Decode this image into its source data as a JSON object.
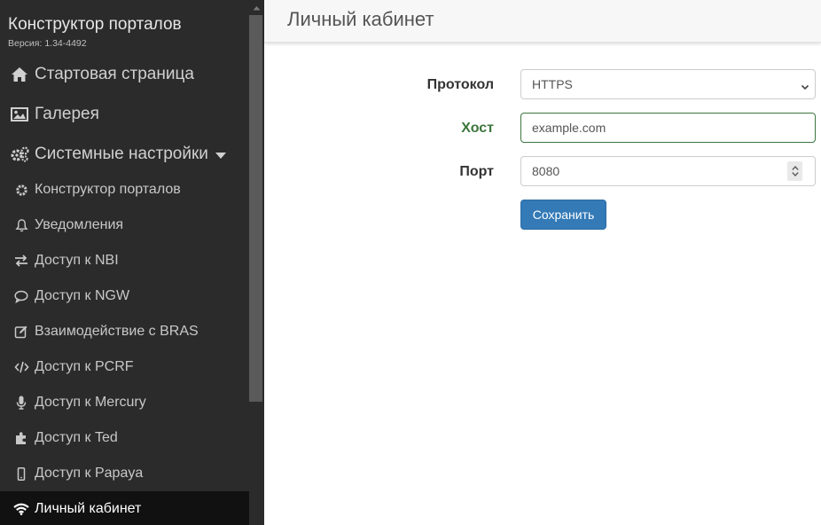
{
  "sidebar": {
    "brand": "Конструктор порталов",
    "version": "Версия: 1.34-4492",
    "top_items": [
      {
        "label": "Стартовая страница",
        "icon": "home-icon"
      },
      {
        "label": "Галерея",
        "icon": "image-icon"
      },
      {
        "label": "Системные настройки",
        "icon": "cogs-icon"
      }
    ],
    "sub_items": [
      {
        "label": "Конструктор порталов",
        "icon": "gear-icon"
      },
      {
        "label": "Уведомления",
        "icon": "bell-icon"
      },
      {
        "label": "Доступ к NBI",
        "icon": "exchange-icon"
      },
      {
        "label": "Доступ к NGW",
        "icon": "comment-icon"
      },
      {
        "label": "Взаимодействие с BRAS",
        "icon": "edit-icon"
      },
      {
        "label": "Доступ к PCRF",
        "icon": "code-icon"
      },
      {
        "label": "Доступ к Mercury",
        "icon": "microphone-icon"
      },
      {
        "label": "Доступ к Ted",
        "icon": "puzzle-icon"
      },
      {
        "label": "Доступ к Papaya",
        "icon": "mobile-icon"
      },
      {
        "label": "Личный кабинет",
        "icon": "wifi-icon",
        "active": true
      }
    ]
  },
  "header": {
    "title": "Личный кабинет"
  },
  "form": {
    "protocol": {
      "label": "Протокол",
      "value": "HTTPS"
    },
    "host": {
      "label": "Хост",
      "value": "example.com"
    },
    "port": {
      "label": "Порт",
      "value": "8080"
    },
    "save_label": "Сохранить"
  },
  "colors": {
    "sidebar_bg": "#2b2b2b",
    "active_bg": "#111111",
    "primary": "#337ab7",
    "success": "#3c763d"
  }
}
